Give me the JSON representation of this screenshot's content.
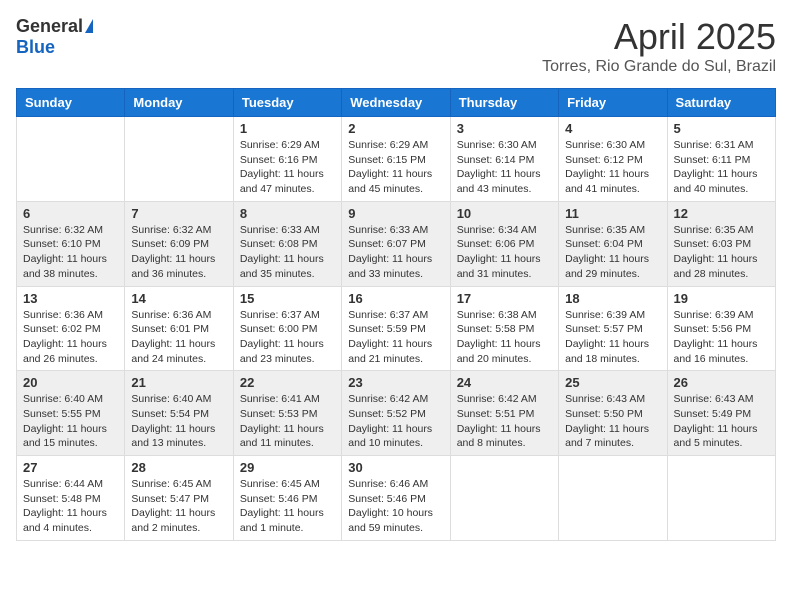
{
  "header": {
    "logo_general": "General",
    "logo_blue": "Blue",
    "main_title": "April 2025",
    "subtitle": "Torres, Rio Grande do Sul, Brazil"
  },
  "weekdays": [
    "Sunday",
    "Monday",
    "Tuesday",
    "Wednesday",
    "Thursday",
    "Friday",
    "Saturday"
  ],
  "weeks": [
    [
      {
        "day": "",
        "info": ""
      },
      {
        "day": "",
        "info": ""
      },
      {
        "day": "1",
        "info": "Sunrise: 6:29 AM\nSunset: 6:16 PM\nDaylight: 11 hours and 47 minutes."
      },
      {
        "day": "2",
        "info": "Sunrise: 6:29 AM\nSunset: 6:15 PM\nDaylight: 11 hours and 45 minutes."
      },
      {
        "day": "3",
        "info": "Sunrise: 6:30 AM\nSunset: 6:14 PM\nDaylight: 11 hours and 43 minutes."
      },
      {
        "day": "4",
        "info": "Sunrise: 6:30 AM\nSunset: 6:12 PM\nDaylight: 11 hours and 41 minutes."
      },
      {
        "day": "5",
        "info": "Sunrise: 6:31 AM\nSunset: 6:11 PM\nDaylight: 11 hours and 40 minutes."
      }
    ],
    [
      {
        "day": "6",
        "info": "Sunrise: 6:32 AM\nSunset: 6:10 PM\nDaylight: 11 hours and 38 minutes."
      },
      {
        "day": "7",
        "info": "Sunrise: 6:32 AM\nSunset: 6:09 PM\nDaylight: 11 hours and 36 minutes."
      },
      {
        "day": "8",
        "info": "Sunrise: 6:33 AM\nSunset: 6:08 PM\nDaylight: 11 hours and 35 minutes."
      },
      {
        "day": "9",
        "info": "Sunrise: 6:33 AM\nSunset: 6:07 PM\nDaylight: 11 hours and 33 minutes."
      },
      {
        "day": "10",
        "info": "Sunrise: 6:34 AM\nSunset: 6:06 PM\nDaylight: 11 hours and 31 minutes."
      },
      {
        "day": "11",
        "info": "Sunrise: 6:35 AM\nSunset: 6:04 PM\nDaylight: 11 hours and 29 minutes."
      },
      {
        "day": "12",
        "info": "Sunrise: 6:35 AM\nSunset: 6:03 PM\nDaylight: 11 hours and 28 minutes."
      }
    ],
    [
      {
        "day": "13",
        "info": "Sunrise: 6:36 AM\nSunset: 6:02 PM\nDaylight: 11 hours and 26 minutes."
      },
      {
        "day": "14",
        "info": "Sunrise: 6:36 AM\nSunset: 6:01 PM\nDaylight: 11 hours and 24 minutes."
      },
      {
        "day": "15",
        "info": "Sunrise: 6:37 AM\nSunset: 6:00 PM\nDaylight: 11 hours and 23 minutes."
      },
      {
        "day": "16",
        "info": "Sunrise: 6:37 AM\nSunset: 5:59 PM\nDaylight: 11 hours and 21 minutes."
      },
      {
        "day": "17",
        "info": "Sunrise: 6:38 AM\nSunset: 5:58 PM\nDaylight: 11 hours and 20 minutes."
      },
      {
        "day": "18",
        "info": "Sunrise: 6:39 AM\nSunset: 5:57 PM\nDaylight: 11 hours and 18 minutes."
      },
      {
        "day": "19",
        "info": "Sunrise: 6:39 AM\nSunset: 5:56 PM\nDaylight: 11 hours and 16 minutes."
      }
    ],
    [
      {
        "day": "20",
        "info": "Sunrise: 6:40 AM\nSunset: 5:55 PM\nDaylight: 11 hours and 15 minutes."
      },
      {
        "day": "21",
        "info": "Sunrise: 6:40 AM\nSunset: 5:54 PM\nDaylight: 11 hours and 13 minutes."
      },
      {
        "day": "22",
        "info": "Sunrise: 6:41 AM\nSunset: 5:53 PM\nDaylight: 11 hours and 11 minutes."
      },
      {
        "day": "23",
        "info": "Sunrise: 6:42 AM\nSunset: 5:52 PM\nDaylight: 11 hours and 10 minutes."
      },
      {
        "day": "24",
        "info": "Sunrise: 6:42 AM\nSunset: 5:51 PM\nDaylight: 11 hours and 8 minutes."
      },
      {
        "day": "25",
        "info": "Sunrise: 6:43 AM\nSunset: 5:50 PM\nDaylight: 11 hours and 7 minutes."
      },
      {
        "day": "26",
        "info": "Sunrise: 6:43 AM\nSunset: 5:49 PM\nDaylight: 11 hours and 5 minutes."
      }
    ],
    [
      {
        "day": "27",
        "info": "Sunrise: 6:44 AM\nSunset: 5:48 PM\nDaylight: 11 hours and 4 minutes."
      },
      {
        "day": "28",
        "info": "Sunrise: 6:45 AM\nSunset: 5:47 PM\nDaylight: 11 hours and 2 minutes."
      },
      {
        "day": "29",
        "info": "Sunrise: 6:45 AM\nSunset: 5:46 PM\nDaylight: 11 hours and 1 minute."
      },
      {
        "day": "30",
        "info": "Sunrise: 6:46 AM\nSunset: 5:46 PM\nDaylight: 10 hours and 59 minutes."
      },
      {
        "day": "",
        "info": ""
      },
      {
        "day": "",
        "info": ""
      },
      {
        "day": "",
        "info": ""
      }
    ]
  ]
}
